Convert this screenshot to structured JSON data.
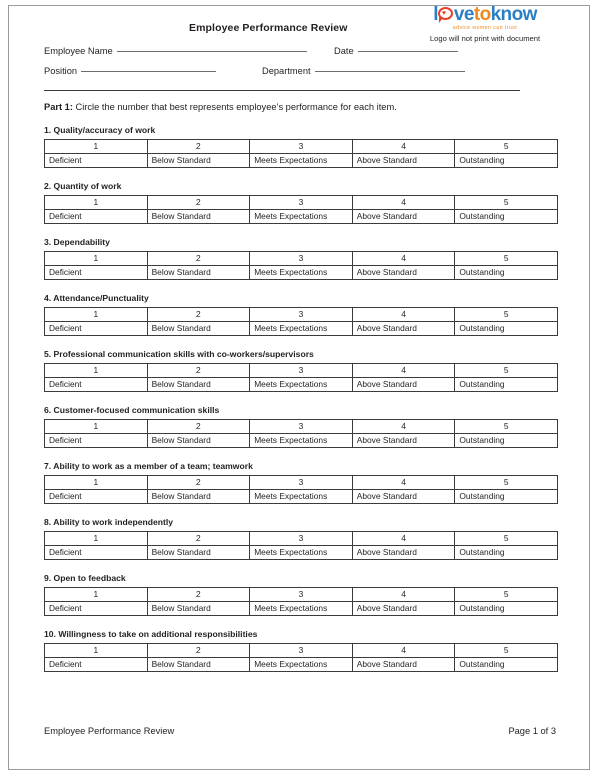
{
  "document": {
    "title": "Employee Performance Review",
    "footer_title": "Employee Performance Review",
    "page_label": "Page 1 of 3"
  },
  "logo": {
    "part_l": "l",
    "part_ve": "ve",
    "part_to": "to",
    "part_know": "know",
    "heart_glyph": "♥",
    "tagline": "advice women can trust",
    "note": "Logo will not print with document",
    "color_blue": "#2b7fc4",
    "color_orange": "#f08a1c",
    "color_red": "#e8402a"
  },
  "fields": {
    "employee_name_label": "Employee Name",
    "employee_name_value": "",
    "date_label": "Date",
    "date_value": "",
    "position_label": "Position",
    "position_value": "",
    "department_label": "Department",
    "department_value": ""
  },
  "part1": {
    "label": "Part 1:",
    "instruction": "Circle the number that best represents employee’s performance for each item."
  },
  "scale": {
    "scores": [
      "1",
      "2",
      "3",
      "4",
      "5"
    ],
    "labels": [
      "Deficient",
      "Below Standard",
      "Meets Expectations",
      "Above Standard",
      "Outstanding"
    ]
  },
  "items": [
    {
      "number": "1.",
      "title": "1. Quality/accuracy of work"
    },
    {
      "number": "2.",
      "title": "2. Quantity of work"
    },
    {
      "number": "3.",
      "title": "3. Dependability"
    },
    {
      "number": "4.",
      "title": "4. Attendance/Punctuality"
    },
    {
      "number": "5.",
      "title": "5. Professional communication skills with co-workers/supervisors"
    },
    {
      "number": "6.",
      "title": "6. Customer-focused communication skills"
    },
    {
      "number": "7.",
      "title": "7. Ability to work as a member of a team; teamwork"
    },
    {
      "number": "8.",
      "title": "8. Ability to work independently"
    },
    {
      "number": "9.",
      "title": "9. Open to feedback"
    },
    {
      "number": "10.",
      "title": "10. Willingness to take on additional responsibilities"
    }
  ]
}
